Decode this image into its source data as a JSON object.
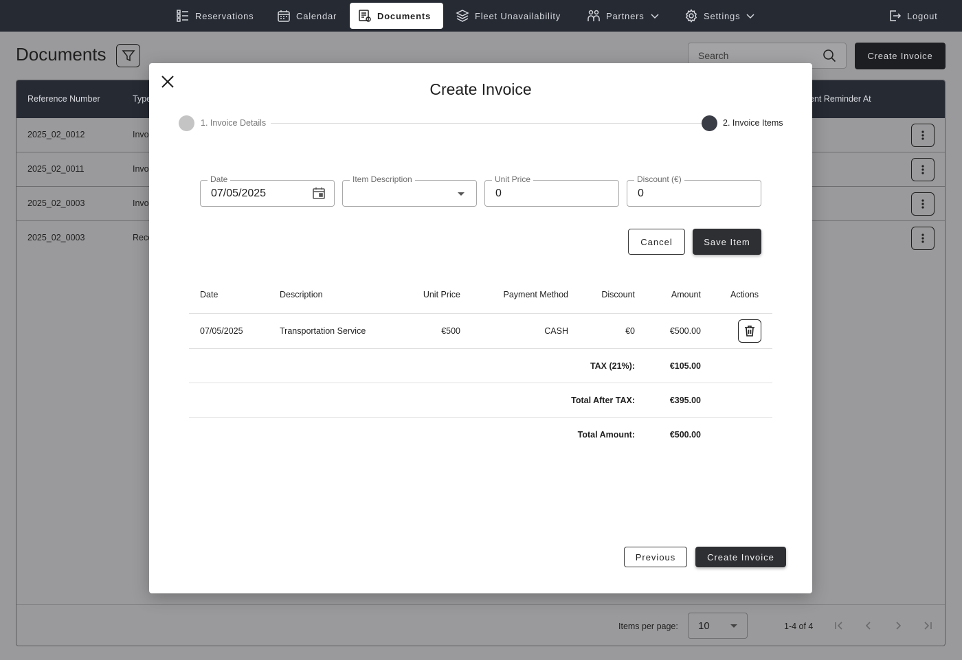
{
  "nav": {
    "items": [
      {
        "label": "Reservations",
        "icon": "list-icon"
      },
      {
        "label": "Calendar",
        "icon": "calendar-icon"
      },
      {
        "label": "Documents",
        "icon": "document-icon",
        "active": true
      },
      {
        "label": "Fleet Unavailability",
        "icon": "layers-icon"
      },
      {
        "label": "Partners",
        "icon": "partners-icon"
      },
      {
        "label": "Settings",
        "icon": "gear-icon"
      },
      {
        "label": "Logout",
        "icon": "logout-icon"
      }
    ]
  },
  "page": {
    "title": "Documents",
    "search_placeholder": "Search",
    "create_button": "Create Invoice"
  },
  "bg_table": {
    "headers": [
      "Reference Number",
      "Type",
      "ent Reminder At"
    ],
    "rows": [
      {
        "ref": "2025_02_0012",
        "type": "Invo"
      },
      {
        "ref": "2025_02_0011",
        "type": "Invo"
      },
      {
        "ref": "2025_02_0003",
        "type": "Invo"
      },
      {
        "ref": "2025_02_0003",
        "type": "Rece"
      }
    ],
    "items_per_page_label": "Items per page:",
    "items_per_page_value": "10",
    "range": "1-4 of 4"
  },
  "modal": {
    "title": "Create Invoice",
    "steps": [
      {
        "label": "1. Invoice Details",
        "color": "#c4c4c4"
      },
      {
        "label": "2. Invoice Items",
        "color": "#3a3d45"
      }
    ],
    "form": {
      "date_label": "Date",
      "date_value": "07/05/2025",
      "description_label": "Item Description",
      "description_value": "",
      "unit_price_label": "Unit Price",
      "unit_price_value": "0",
      "discount_label": "Discount (€)",
      "discount_value": "0"
    },
    "cancel_label": "Cancel",
    "save_label": "Save Item",
    "table": {
      "headers": {
        "date": "Date",
        "description": "Description",
        "unit_price": "Unit Price",
        "payment_method": "Payment Method",
        "discount": "Discount",
        "amount": "Amount",
        "actions": "Actions"
      },
      "items": [
        {
          "date": "07/05/2025",
          "description": "Transportation Service",
          "unit_price": "€500",
          "payment_method": "CASH",
          "discount": "€0",
          "amount": "€500.00"
        }
      ],
      "totals": [
        {
          "label": "TAX (21%):",
          "value": "€105.00"
        },
        {
          "label": "Total After TAX:",
          "value": "€395.00"
        },
        {
          "label": "Total Amount:",
          "value": "€500.00"
        }
      ]
    },
    "previous_label": "Previous",
    "create_label": "Create Invoice"
  }
}
